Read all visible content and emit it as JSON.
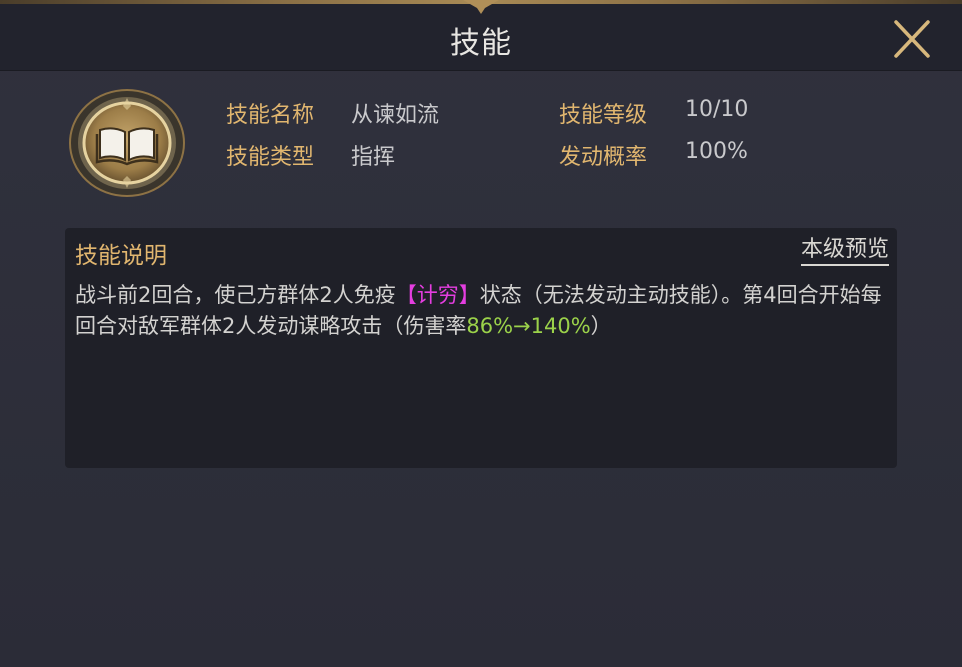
{
  "dialog": {
    "title": "技能"
  },
  "skill": {
    "icon": "open-book-icon",
    "name_label": "技能名称",
    "name_value": "从谏如流",
    "type_label": "技能类型",
    "type_value": "指挥",
    "level_label": "技能等级",
    "level_value": "10/10",
    "chance_label": "发动概率",
    "chance_value": "100%"
  },
  "description": {
    "title": "技能说明",
    "preview_link": "本级预览",
    "text_part1": "战斗前2回合，使己方群体2人免疫",
    "state_text": "【计穷】",
    "text_part2": "状态（无法发动主动技能）。第4回合开始每回合对敌军群体2人发动谋略攻击（伤害率",
    "damage_text": "86%→140%",
    "text_part3": "）"
  },
  "colors": {
    "label_gold": "#e1b66f",
    "state_magenta": "#e43ee0",
    "damage_green": "#9bd24a"
  }
}
